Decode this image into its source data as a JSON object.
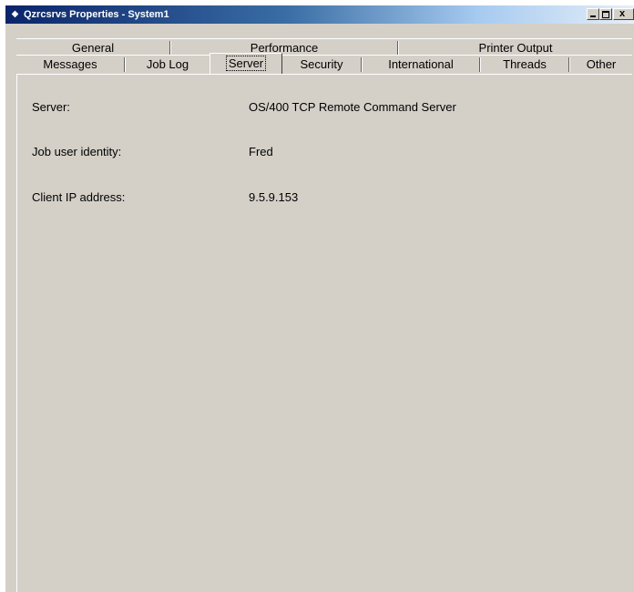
{
  "window": {
    "title": "Qzrcsrvs Properties - System1",
    "minimize_icon": "minimize-icon",
    "maximize_icon": "maximize-icon",
    "close_icon": "close-icon"
  },
  "tabs": {
    "row1": [
      "General",
      "Performance",
      "Printer Output"
    ],
    "row2": [
      "Messages",
      "Job Log",
      "Server",
      "Security",
      "International",
      "Threads",
      "Other"
    ],
    "selected": "Server"
  },
  "fields": [
    {
      "label": "Server:",
      "value": "OS/400 TCP Remote Command Server"
    },
    {
      "label": "Job user identity:",
      "value": "Fred"
    },
    {
      "label": "Client IP address:",
      "value": "9.5.9.153"
    }
  ]
}
